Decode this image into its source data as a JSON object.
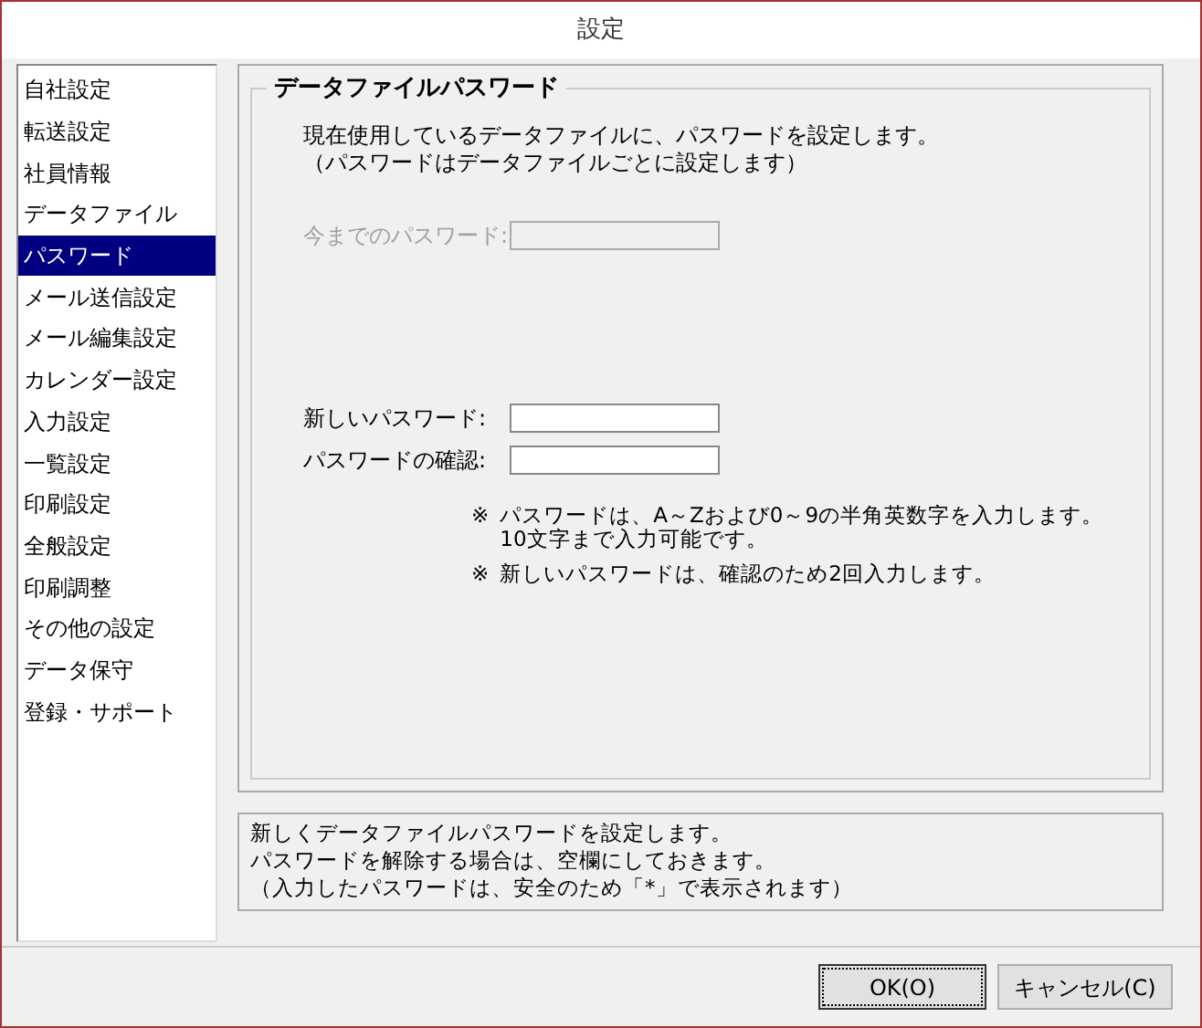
{
  "window": {
    "title": "設定"
  },
  "sidebar": {
    "items": [
      {
        "label": "自社設定",
        "selected": false
      },
      {
        "label": "転送設定",
        "selected": false
      },
      {
        "label": "社員情報",
        "selected": false
      },
      {
        "label": "データファイル",
        "selected": false
      },
      {
        "label": "パスワード",
        "selected": true
      },
      {
        "label": "メール送信設定",
        "selected": false
      },
      {
        "label": "メール編集設定",
        "selected": false
      },
      {
        "label": "カレンダー設定",
        "selected": false
      },
      {
        "label": "入力設定",
        "selected": false
      },
      {
        "label": "一覧設定",
        "selected": false
      },
      {
        "label": "印刷設定",
        "selected": false
      },
      {
        "label": "全般設定",
        "selected": false
      },
      {
        "label": "印刷調整",
        "selected": false
      },
      {
        "label": "その他の設定",
        "selected": false
      },
      {
        "label": "データ保守",
        "selected": false
      },
      {
        "label": "登録・サポート",
        "selected": false
      }
    ]
  },
  "group": {
    "title": "データファイルパスワード",
    "intro": [
      "現在使用しているデータファイルに、パスワードを設定します。",
      "（パスワードはデータファイルごとに設定します）"
    ],
    "fields": [
      {
        "label": "今までのパスワード:",
        "disabled": true
      },
      {
        "label": "新しいパスワード:",
        "disabled": false
      },
      {
        "label": "パスワードの確認:",
        "disabled": false
      }
    ],
    "notes": [
      [
        "※",
        "パスワードは、A～Zおよび0～9の半角英数字を入力します。",
        "10文字まで入力可能です。"
      ],
      [
        "※",
        "新しいパスワードは、確認のため2回入力します。"
      ]
    ]
  },
  "description": [
    "新しくデータファイルパスワードを設定します。",
    "パスワードを解除する場合は、空欄にしておきます。",
    "（入力したパスワードは、安全のため「*」で表示されます）"
  ],
  "buttons": [
    {
      "label": "OK(O)",
      "focused": true
    },
    {
      "label": "キャンセル(C)",
      "focused": false
    }
  ]
}
